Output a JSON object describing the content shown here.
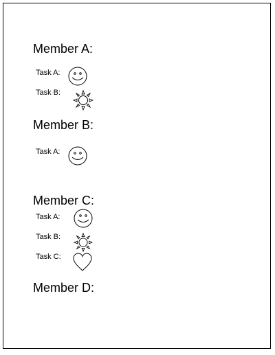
{
  "members": [
    {
      "heading": "Member A:",
      "tasks": [
        {
          "label": "Task A:",
          "icon": "smiley-face-icon"
        },
        {
          "label": "Task B:",
          "icon": "sun-icon"
        }
      ]
    },
    {
      "heading": "Member B:",
      "tasks": [
        {
          "label": "Task A:",
          "icon": "smiley-face-icon"
        }
      ]
    },
    {
      "heading": "Member C:",
      "tasks": [
        {
          "label": "Task A:",
          "icon": "smiley-face-icon"
        },
        {
          "label": "Task B:",
          "icon": "sun-icon"
        },
        {
          "label": "Task C:",
          "icon": "heart-icon"
        }
      ]
    },
    {
      "heading": "Member D:",
      "tasks": []
    }
  ]
}
